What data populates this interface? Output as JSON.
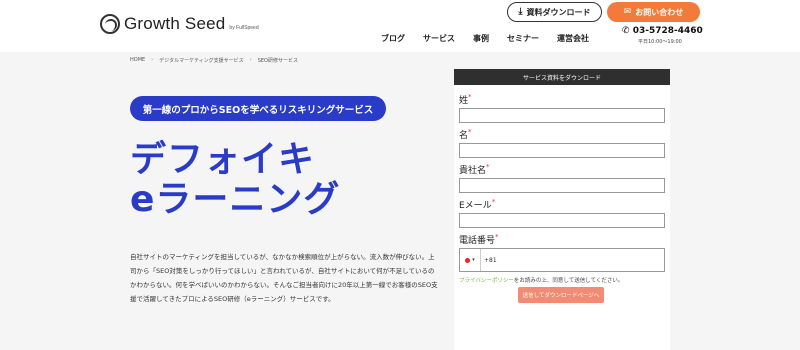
{
  "header": {
    "logo_text": "Growth Seed",
    "logo_by": "by FullSpeed",
    "download_label": "資料ダウンロード",
    "contact_label": "お問い合わせ",
    "nav": [
      "ブログ",
      "サービス",
      "事例",
      "セミナー",
      "運営会社"
    ],
    "phone": "03-5728-4460",
    "hours": "平日10:00〜19:00"
  },
  "breadcrumb": [
    "HOME",
    "デジタルマーケティング支援サービス",
    "SEO研修サービス"
  ],
  "hero": {
    "tagline": "第一線のプロからSEOを学べるリスキリングサービス",
    "title_line1": "デフォイキ",
    "title_line2": "eラーニング",
    "description": "自社サイトのマーケティングを担当しているが、なかなか検索順位が上がらない。流入数が伸びない。上司から「SEO対策をしっかり行ってほしい」と言われているが、自社サイトにおいて何が不足しているのかわからない。何を学べばいいのかわからない。そんなご担当者向けに20年以上第一線でお客様のSEO支援で活躍してきたプロによるSEO研修（eラーニング）サービスです。"
  },
  "form": {
    "header": "サービス資料をダウンロード",
    "fields": [
      "姓",
      "名",
      "貴社名",
      "Eメール",
      "電話番号"
    ],
    "required_mark": "*",
    "dial_code": "+81",
    "privacy_link": "プライバシーポリシー",
    "privacy_text": "をお読みの上、同意して送信してください。",
    "submit_label": "送信してダウンロードページへ"
  },
  "colors": {
    "brand_blue": "#2a3bc7",
    "accent_orange": "#f47a3b",
    "submit": "#f28a74"
  }
}
